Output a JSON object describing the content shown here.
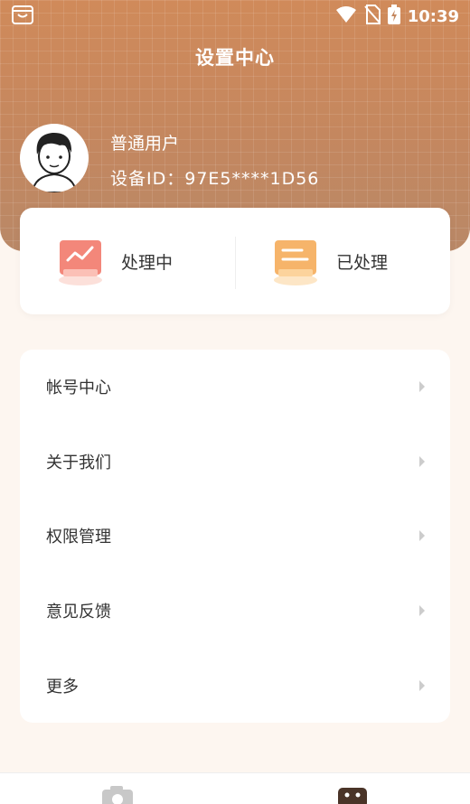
{
  "status_bar": {
    "time": "10:39",
    "icons": [
      "store-icon",
      "wifi-icon",
      "no-sim-icon",
      "battery-charging-icon"
    ]
  },
  "header": {
    "title": "设置中心"
  },
  "profile": {
    "username": "普通用户",
    "device_id": "设备ID：97E5****1D56"
  },
  "status_card": {
    "items": [
      {
        "label": "处理中",
        "icon": "chart-trend-icon",
        "color": "#f08a7a"
      },
      {
        "label": "已处理",
        "icon": "document-icon",
        "color": "#f5b56a"
      }
    ]
  },
  "menu": {
    "items": [
      {
        "label": "帐号中心"
      },
      {
        "label": "关于我们"
      },
      {
        "label": "权限管理"
      },
      {
        "label": "意见反馈"
      },
      {
        "label": "更多"
      }
    ]
  },
  "bottom_nav": {
    "items": [
      {
        "icon": "camera-icon"
      },
      {
        "icon": "profile-tab-icon",
        "active": true
      }
    ]
  },
  "colors": {
    "header": "#c4875f",
    "background": "#fdf6f0"
  }
}
